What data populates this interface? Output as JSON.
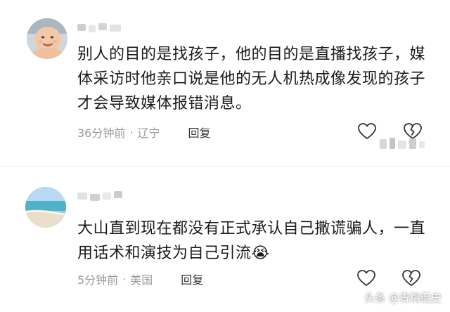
{
  "comments": [
    {
      "avatar_icon": "baby-avatar",
      "text": "别人的目的是找孩子，他的目的是直播找孩子，媒体采访时他亲口说是他的无人机热成像发现的孩子才会导致媒体报错消息。",
      "time": "36分钟前",
      "separator": "·",
      "location": "辽宁",
      "reply_label": "回复",
      "like_icon": "heart-outline-icon",
      "dislike_icon": "broken-heart-icon"
    },
    {
      "avatar_icon": "beach-avatar",
      "text": "大山直到现在都没有正式承认自己撒谎骗人，一直用话术和演技为自己引流",
      "emoji": "😭",
      "time": "5分钟前",
      "separator": "·",
      "location": "美国",
      "reply_label": "回复",
      "like_icon": "heart-outline-icon",
      "dislike_icon": "broken-heart-icon"
    }
  ],
  "watermark": "头条 @青梅侃史"
}
